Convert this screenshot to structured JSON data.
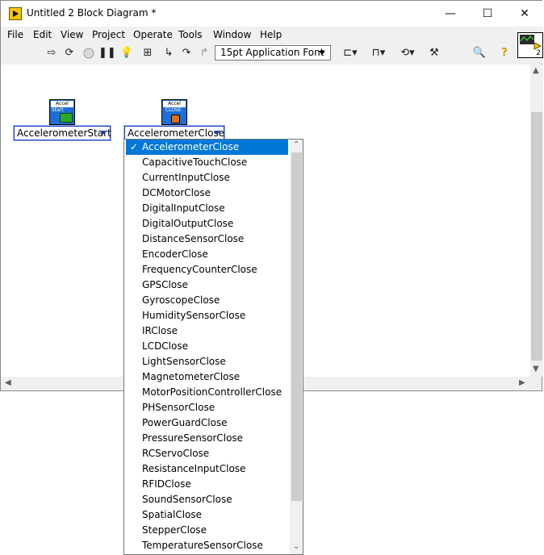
{
  "window": {
    "title": "Untitled 2 Block Diagram *",
    "controls": [
      "—",
      "☐",
      "✕"
    ]
  },
  "menu": [
    "File",
    "Edit",
    "View",
    "Project",
    "Operate",
    "Tools",
    "Window",
    "Help"
  ],
  "toolbar": {
    "font": "15pt Application Font",
    "icons": [
      "run-arrow-icon",
      "run-continuous-icon",
      "abort-icon",
      "pause-icon",
      "highlight-execution-icon",
      "retain-wire-values-icon",
      "step-into-icon",
      "step-over-icon",
      "step-out-icon",
      "align-icon",
      "distribute-icon",
      "reorder-icon",
      "clean-up-icon",
      "search-icon",
      "context-help-icon"
    ]
  },
  "vi_icon": {
    "number": "2"
  },
  "nodes": [
    {
      "icon_header": "Accel",
      "icon_sub": "Start",
      "ring_value": "AccelerometerStart"
    },
    {
      "icon_header": "Accel",
      "icon_sub": "CLOSE",
      "ring_value": "AccelerometerClose"
    }
  ],
  "dropdown": {
    "selected_mark": "✓",
    "items": [
      "AccelerometerClose",
      "CapacitiveTouchClose",
      "CurrentInputClose",
      "DCMotorClose",
      "DigitalInputClose",
      "DigitalOutputClose",
      "DistanceSensorClose",
      "EncoderClose",
      "FrequencyCounterClose",
      "GPSClose",
      "GyroscopeClose",
      "HumiditySensorClose",
      "IRClose",
      "LCDClose",
      "LightSensorClose",
      "MagnetometerClose",
      "MotorPositionControllerClose",
      "PHSensorClose",
      "PowerGuardClose",
      "PressureSensorClose",
      "RCServoClose",
      "ResistanceInputClose",
      "RFIDClose",
      "SoundSensorClose",
      "SpatialClose",
      "StepperClose",
      "TemperatureSensorClose"
    ]
  }
}
